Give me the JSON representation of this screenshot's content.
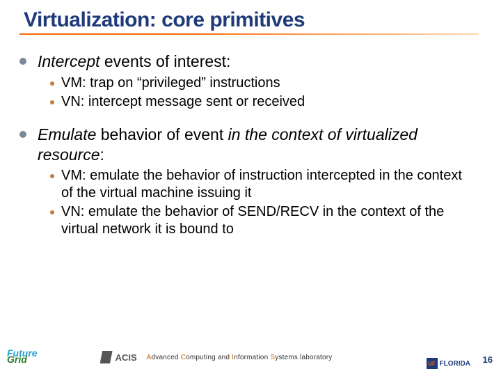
{
  "title": "Virtualization: core primitives",
  "bullets": [
    {
      "lead": "Intercept",
      "rest": " events of interest:",
      "subs": [
        "VM: trap on “privileged” instructions",
        "VN: intercept message sent or received"
      ]
    },
    {
      "lead": "Emulate",
      "rest_pre": " behavior of event ",
      "rest_it": "in the context of virtualized resource",
      "rest_post": ":",
      "subs": [
        "VM: emulate the behavior of instruction intercepted in the context of the virtual machine issuing it",
        "VN: emulate the behavior of SEND/RECV in the context of the virtual network it is bound to"
      ]
    }
  ],
  "footer": {
    "fg_top": "Future",
    "fg_bot": "Grid",
    "acis": "ACIS",
    "lab_a": "A",
    "lab_c": "C",
    "lab_i": "I",
    "lab_s": "S",
    "lab_rest1": "dvanced ",
    "lab_rest2": "omputing and ",
    "lab_rest3": "nformation ",
    "lab_rest4": "ystems laboratory",
    "uf_box": "UF",
    "uf_text": "FLORIDA"
  },
  "page": "16"
}
